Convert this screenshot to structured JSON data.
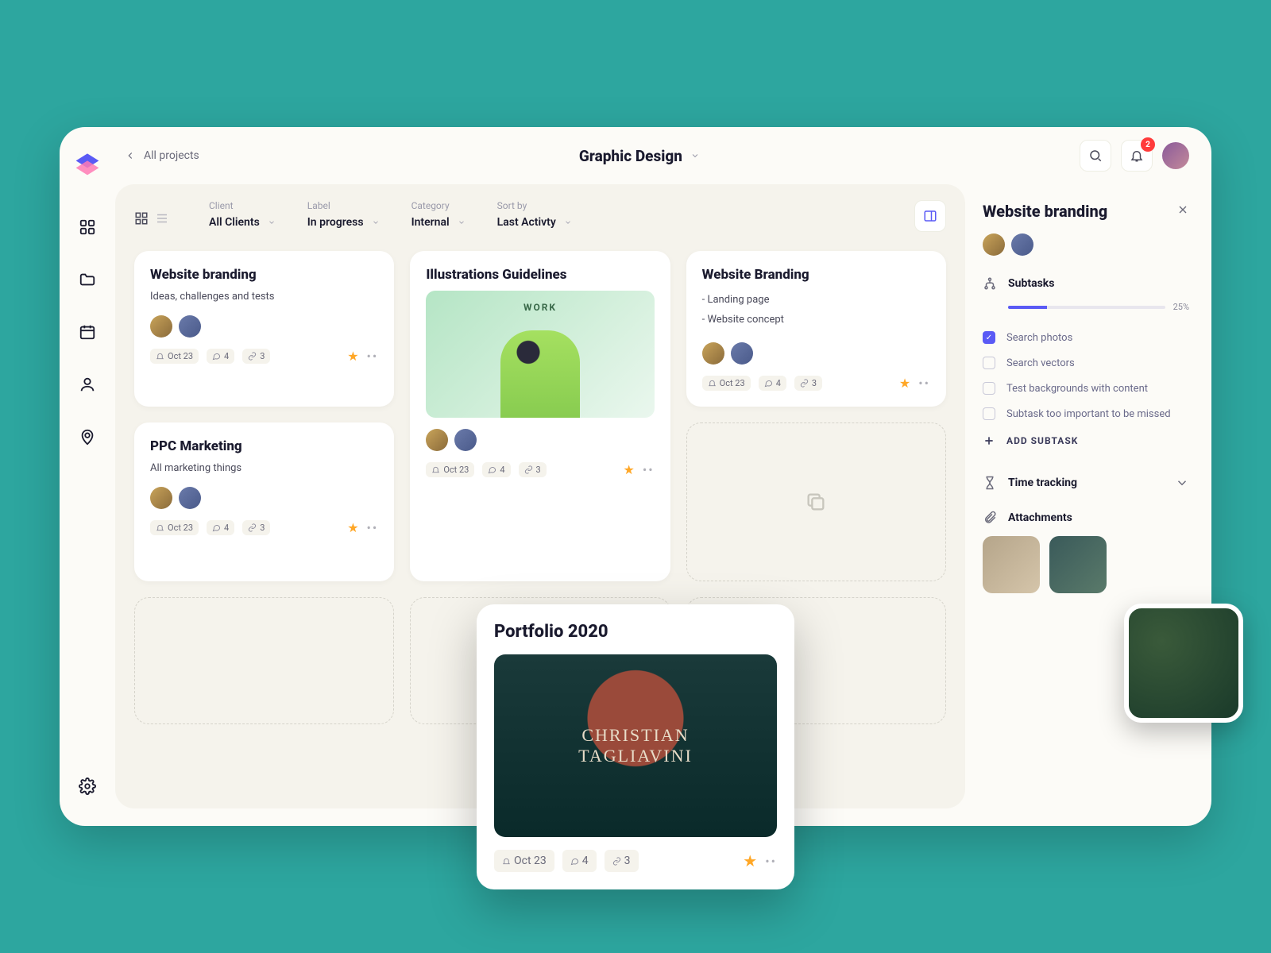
{
  "header": {
    "back_label": "All projects",
    "title": "Graphic Design",
    "notification_count": "2"
  },
  "filters": {
    "client": {
      "label": "Client",
      "value": "All Clients"
    },
    "label": {
      "label": "Label",
      "value": "In progress"
    },
    "category": {
      "label": "Category",
      "value": "Internal"
    },
    "sort": {
      "label": "Sort by",
      "value": "Last Activty"
    }
  },
  "cards": [
    {
      "title": "Website branding",
      "desc": "Ideas, challenges and tests",
      "date": "Oct 23",
      "comments": "4",
      "links": "3"
    },
    {
      "title": "Illustrations Guidelines",
      "work_tag": "WORK",
      "date": "Oct 23",
      "comments": "4",
      "links": "3"
    },
    {
      "title": "Website Branding",
      "b1": "- Landing page",
      "b2": "- Website concept",
      "date": "Oct 23",
      "comments": "4",
      "links": "3"
    },
    {
      "title": "PPC Marketing",
      "desc": "All marketing things",
      "date": "Oct 23",
      "comments": "4",
      "links": "3"
    }
  ],
  "float": {
    "title": "Portfolio 2020",
    "img_line1": "CHRISTIAN",
    "img_line2": "TAGLIAVINI",
    "date": "Oct 23",
    "comments": "4",
    "links": "3"
  },
  "detail": {
    "title": "Website branding",
    "subtasks_label": "Subtasks",
    "progress_pct": 25,
    "progress_label": "25%",
    "tasks": [
      {
        "label": "Search photos",
        "done": true
      },
      {
        "label": "Search vectors",
        "done": false
      },
      {
        "label": "Test backgrounds with content",
        "done": false
      },
      {
        "label": "Subtask too important to be missed",
        "done": false
      }
    ],
    "add_subtask": "ADD SUBTASK",
    "time_tracking": "Time tracking",
    "attachments": "Attachments"
  }
}
